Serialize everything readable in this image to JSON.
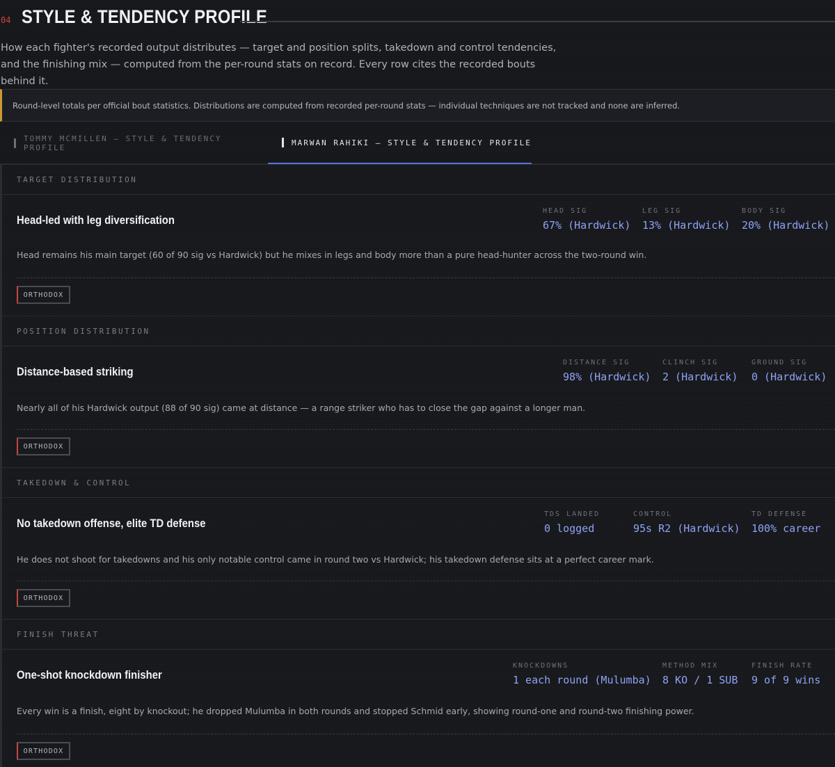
{
  "section": {
    "number": "04",
    "title": "STYLE & TENDENCY PROFILE",
    "intro": "How each fighter's recorded output distributes — target and position splits, takedown and control tendencies, and the finishing mix — computed from the per-round stats on record. Every row cites the recorded bouts behind it."
  },
  "notice": "Round-level totals per official bout statistics. Distributions are computed from recorded per-round stats — individual techniques are not tracked and none are inferred.",
  "tabs": [
    {
      "label": "TOMMY MCMILLEN — STYLE & TENDENCY PROFILE",
      "active": false
    },
    {
      "label": "MARWAN RAHIKI — STYLE & TENDENCY PROFILE",
      "active": true
    }
  ],
  "colors": {
    "accent": "#8ea3f5",
    "tab_underline": "#5a6fe0",
    "section_number": "#d0453a",
    "notice_border": "#c99a2e",
    "badge_edge": "#c4473d"
  },
  "panels": [
    {
      "heading": "TARGET DISTRIBUTION",
      "title": "Head-led with leg diversification",
      "stats": [
        {
          "label": "HEAD SIG",
          "value": "67% (Hardwick)"
        },
        {
          "label": "LEG SIG",
          "value": "13% (Hardwick)"
        },
        {
          "label": "BODY SIG",
          "value": "20% (Hardwick)"
        }
      ],
      "description": "Head remains his main target (60 of 90 sig vs Hardwick) but he mixes in legs and body more than a pure head-hunter across the two-round win.",
      "badge": "ORTHODOX"
    },
    {
      "heading": "POSITION DISTRIBUTION",
      "title": "Distance-based striking",
      "stats": [
        {
          "label": "DISTANCE SIG",
          "value": "98% (Hardwick)"
        },
        {
          "label": "CLINCH SIG",
          "value": "2 (Hardwick)"
        },
        {
          "label": "GROUND SIG",
          "value": "0 (Hardwick)"
        }
      ],
      "description": "Nearly all of his Hardwick output (88 of 90 sig) came at distance — a range striker who has to close the gap against a longer man.",
      "badge": "ORTHODOX"
    },
    {
      "heading": "TAKEDOWN & CONTROL",
      "title": "No takedown offense, elite TD defense",
      "stats": [
        {
          "label": "TDS LANDED",
          "value": "0 logged"
        },
        {
          "label": "CONTROL",
          "value": "95s R2 (Hardwick)"
        },
        {
          "label": "TD DEFENSE",
          "value": "100% career"
        }
      ],
      "description": "He does not shoot for takedowns and his only notable control came in round two vs Hardwick; his takedown defense sits at a perfect career mark.",
      "badge": "ORTHODOX"
    },
    {
      "heading": "FINISH THREAT",
      "title": "One-shot knockdown finisher",
      "stats": [
        {
          "label": "KNOCKDOWNS",
          "value": "1 each round (Mulumba)"
        },
        {
          "label": "METHOD MIX",
          "value": "8 KO / 1 SUB"
        },
        {
          "label": "FINISH RATE",
          "value": "9 of 9 wins"
        }
      ],
      "description": "Every win is a finish, eight by knockout; he dropped Mulumba in both rounds and stopped Schmid early, showing round-one and round-two finishing power.",
      "badge": "ORTHODOX"
    }
  ]
}
